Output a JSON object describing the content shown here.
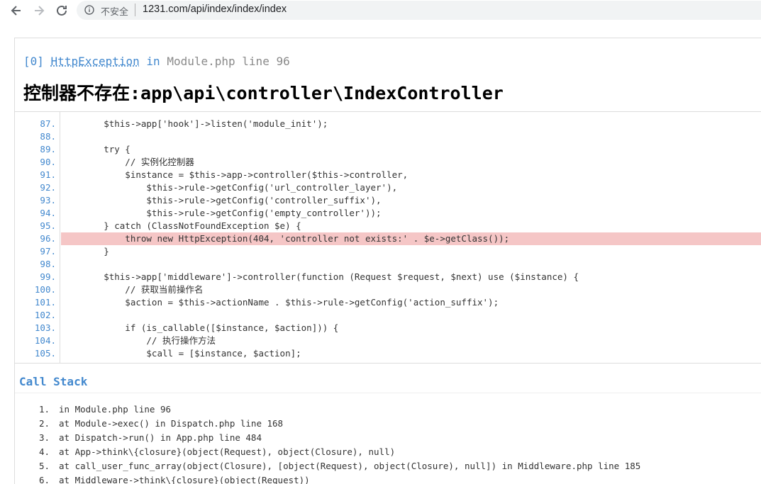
{
  "browser": {
    "security_label": "不安全",
    "url": "1231.com/api/index/index/index"
  },
  "exception": {
    "index": "[0]",
    "class_name": "HttpException",
    "in_word": "in",
    "location": "Module.php line 96",
    "message": "控制器不存在:app\\api\\controller\\IndexController"
  },
  "source_lines": [
    {
      "n": "87.",
      "code": "        $this->app['hook']->listen('module_init');",
      "hl": false
    },
    {
      "n": "88.",
      "code": "",
      "hl": false
    },
    {
      "n": "89.",
      "code": "        try {",
      "hl": false
    },
    {
      "n": "90.",
      "code": "            // 实例化控制器",
      "hl": false
    },
    {
      "n": "91.",
      "code": "            $instance = $this->app->controller($this->controller,",
      "hl": false
    },
    {
      "n": "92.",
      "code": "                $this->rule->getConfig('url_controller_layer'),",
      "hl": false
    },
    {
      "n": "93.",
      "code": "                $this->rule->getConfig('controller_suffix'),",
      "hl": false
    },
    {
      "n": "94.",
      "code": "                $this->rule->getConfig('empty_controller'));",
      "hl": false
    },
    {
      "n": "95.",
      "code": "        } catch (ClassNotFoundException $e) {",
      "hl": false
    },
    {
      "n": "96.",
      "code": "            throw new HttpException(404, 'controller not exists:' . $e->getClass());",
      "hl": true
    },
    {
      "n": "97.",
      "code": "        }",
      "hl": false
    },
    {
      "n": "98.",
      "code": "",
      "hl": false
    },
    {
      "n": "99.",
      "code": "        $this->app['middleware']->controller(function (Request $request, $next) use ($instance) {",
      "hl": false
    },
    {
      "n": "100.",
      "code": "            // 获取当前操作名",
      "hl": false
    },
    {
      "n": "101.",
      "code": "            $action = $this->actionName . $this->rule->getConfig('action_suffix');",
      "hl": false
    },
    {
      "n": "102.",
      "code": "",
      "hl": false
    },
    {
      "n": "103.",
      "code": "            if (is_callable([$instance, $action])) {",
      "hl": false
    },
    {
      "n": "104.",
      "code": "                // 执行操作方法",
      "hl": false
    },
    {
      "n": "105.",
      "code": "                $call = [$instance, $action];",
      "hl": false
    }
  ],
  "call_stack": {
    "title": "Call Stack",
    "items": [
      {
        "n": "1.",
        "text": "in Module.php line 96"
      },
      {
        "n": "2.",
        "text": "at Module->exec() in Dispatch.php line 168"
      },
      {
        "n": "3.",
        "text": "at Dispatch->run() in App.php line 484"
      },
      {
        "n": "4.",
        "text": "at App->think\\{closure}(object(Request), object(Closure), null)"
      },
      {
        "n": "5.",
        "text": "at call_user_func_array(object(Closure), [object(Request), object(Closure), null]) in Middleware.php line 185"
      },
      {
        "n": "6.",
        "text": "at Middleware->think\\{closure}(object(Request))"
      }
    ]
  },
  "colors": {
    "link_blue": "#4288ce",
    "highlight": "#f5c6c6"
  }
}
